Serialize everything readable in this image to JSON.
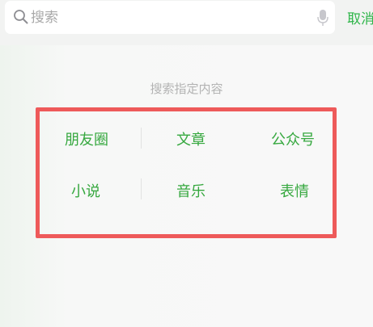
{
  "search": {
    "placeholder": "搜索",
    "value": "",
    "cancel_label": "取消"
  },
  "section_title": "搜索指定内容",
  "categories": [
    {
      "label": "朋友圈"
    },
    {
      "label": "文章"
    },
    {
      "label": "公众号"
    },
    {
      "label": "小说"
    },
    {
      "label": "音乐"
    },
    {
      "label": "表情"
    }
  ],
  "colors": {
    "accent": "#2fb54a",
    "category_text": "#36a83f",
    "highlight_frame": "#ee5a5a",
    "placeholder": "#a9a9a9",
    "section_title": "#b3b3b3"
  },
  "icons": {
    "search": "search-icon",
    "voice": "microphone-icon"
  }
}
